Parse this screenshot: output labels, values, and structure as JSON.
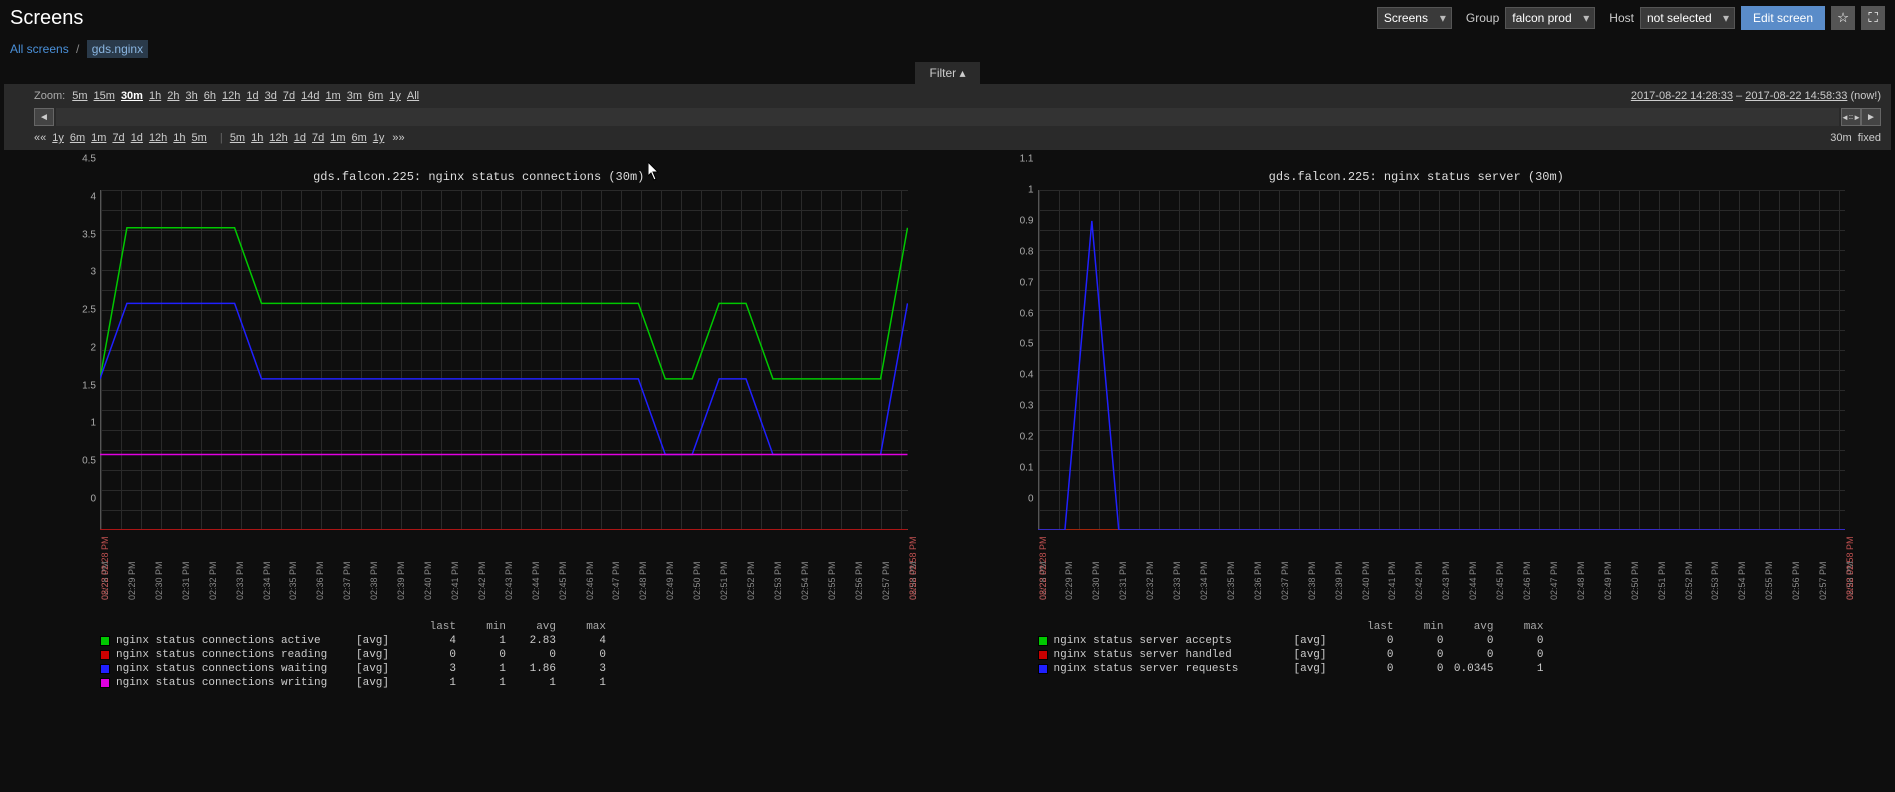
{
  "header": {
    "title": "Screens",
    "screens_label": "Screens",
    "group_label": "Group",
    "group_value": "falcon prod",
    "host_label": "Host",
    "host_value": "not selected",
    "edit_button": "Edit screen"
  },
  "breadcrumb": {
    "root": "All screens",
    "current": "gds.nginx"
  },
  "filter_tab": "Filter",
  "timebar": {
    "zoom_label": "Zoom:",
    "zoom_options": [
      "5m",
      "15m",
      "30m",
      "1h",
      "2h",
      "3h",
      "6h",
      "12h",
      "1d",
      "3d",
      "7d",
      "14d",
      "1m",
      "3m",
      "6m",
      "1y",
      "All"
    ],
    "zoom_active": "30m",
    "from_ts": "2017-08-22 14:28:33",
    "to_ts": "2017-08-22 14:58:33",
    "now": "(now!)",
    "nav_left": [
      "1y",
      "6m",
      "1m",
      "7d",
      "1d",
      "12h",
      "1h",
      "5m"
    ],
    "nav_right": [
      "5m",
      "1h",
      "12h",
      "1d",
      "7d",
      "1m",
      "6m",
      "1y"
    ],
    "range_label": "30m",
    "mode": "fixed"
  },
  "chart_data": [
    {
      "type": "line",
      "title": "gds.falcon.225: nginx status connections (30m)",
      "ylim": [
        0,
        4.5
      ],
      "yticks": [
        0,
        0.5,
        1.0,
        1.5,
        2.0,
        2.5,
        3.0,
        3.5,
        4.0,
        4.5
      ],
      "x": [
        "02:28",
        "02:29",
        "02:30",
        "02:31",
        "02:32",
        "02:33",
        "02:34",
        "02:35",
        "02:36",
        "02:37",
        "02:38",
        "02:39",
        "02:40",
        "02:41",
        "02:42",
        "02:43",
        "02:44",
        "02:45",
        "02:46",
        "02:47",
        "02:48",
        "02:49",
        "02:50",
        "02:51",
        "02:52",
        "02:53",
        "02:54",
        "02:55",
        "02:56",
        "02:57",
        "02:58"
      ],
      "x_labels_edge": [
        "08/22 02:28 PM",
        "08/22 02:58 PM"
      ],
      "series": [
        {
          "name": "nginx status connections active",
          "color": "#00c800",
          "agg": "[avg]",
          "last": 4,
          "min": 1,
          "avg": 2.83,
          "max": 4,
          "values": [
            2,
            4,
            4,
            4,
            4,
            4,
            3,
            3,
            3,
            3,
            3,
            3,
            3,
            3,
            3,
            3,
            3,
            3,
            3,
            3,
            3,
            2,
            2,
            3,
            3,
            2,
            2,
            2,
            2,
            2,
            4
          ]
        },
        {
          "name": "nginx status connections reading",
          "color": "#c80000",
          "agg": "[avg]",
          "last": 0,
          "min": 0,
          "avg": 0,
          "max": 0,
          "values": [
            0,
            0,
            0,
            0,
            0,
            0,
            0,
            0,
            0,
            0,
            0,
            0,
            0,
            0,
            0,
            0,
            0,
            0,
            0,
            0,
            0,
            0,
            0,
            0,
            0,
            0,
            0,
            0,
            0,
            0,
            0
          ]
        },
        {
          "name": "nginx status connections waiting",
          "color": "#2020ff",
          "agg": "[avg]",
          "last": 3,
          "min": 1,
          "avg": 1.86,
          "max": 3,
          "values": [
            2,
            3,
            3,
            3,
            3,
            3,
            2,
            2,
            2,
            2,
            2,
            2,
            2,
            2,
            2,
            2,
            2,
            2,
            2,
            2,
            2,
            1,
            1,
            2,
            2,
            1,
            1,
            1,
            1,
            1,
            3
          ]
        },
        {
          "name": "nginx status connections writing",
          "color": "#e000e0",
          "agg": "[avg]",
          "last": 1,
          "min": 1,
          "avg": 1,
          "max": 1,
          "values": [
            1,
            1,
            1,
            1,
            1,
            1,
            1,
            1,
            1,
            1,
            1,
            1,
            1,
            1,
            1,
            1,
            1,
            1,
            1,
            1,
            1,
            1,
            1,
            1,
            1,
            1,
            1,
            1,
            1,
            1,
            1
          ]
        }
      ]
    },
    {
      "type": "line",
      "title": "gds.falcon.225: nginx status server (30m)",
      "ylim": [
        0,
        1.1
      ],
      "yticks": [
        0,
        0.1,
        0.2,
        0.3,
        0.4,
        0.5,
        0.6,
        0.7,
        0.8,
        0.9,
        1.0,
        1.1
      ],
      "x": [
        "02:28",
        "02:29",
        "02:30",
        "02:31",
        "02:32",
        "02:33",
        "02:34",
        "02:35",
        "02:36",
        "02:37",
        "02:38",
        "02:39",
        "02:40",
        "02:41",
        "02:42",
        "02:43",
        "02:44",
        "02:45",
        "02:46",
        "02:47",
        "02:48",
        "02:49",
        "02:50",
        "02:51",
        "02:52",
        "02:53",
        "02:54",
        "02:55",
        "02:56",
        "02:57",
        "02:58"
      ],
      "x_labels_edge": [
        "08/22 02:28 PM",
        "08/22 02:58 PM"
      ],
      "series": [
        {
          "name": "nginx status server accepts",
          "color": "#00c800",
          "agg": "[avg]",
          "last": 0,
          "min": 0,
          "avg": 0,
          "max": 0,
          "values": [
            0,
            0,
            0,
            0,
            0,
            0,
            0,
            0,
            0,
            0,
            0,
            0,
            0,
            0,
            0,
            0,
            0,
            0,
            0,
            0,
            0,
            0,
            0,
            0,
            0,
            0,
            0,
            0,
            0,
            0,
            0
          ]
        },
        {
          "name": "nginx status server handled",
          "color": "#c80000",
          "agg": "[avg]",
          "last": 0,
          "min": 0,
          "avg": 0,
          "max": 0,
          "values": [
            0,
            0,
            0,
            0,
            0,
            0,
            0,
            0,
            0,
            0,
            0,
            0,
            0,
            0,
            0,
            0,
            0,
            0,
            0,
            0,
            0,
            0,
            0,
            0,
            0,
            0,
            0,
            0,
            0,
            0,
            0
          ]
        },
        {
          "name": "nginx status server requests",
          "color": "#2020ff",
          "agg": "[avg]",
          "last": 0,
          "min": 0,
          "avg": 0.0345,
          "max": 1,
          "values": [
            0,
            0,
            1,
            0,
            0,
            0,
            0,
            0,
            0,
            0,
            0,
            0,
            0,
            0,
            0,
            0,
            0,
            0,
            0,
            0,
            0,
            0,
            0,
            0,
            0,
            0,
            0,
            0,
            0,
            0,
            0
          ]
        }
      ]
    }
  ]
}
